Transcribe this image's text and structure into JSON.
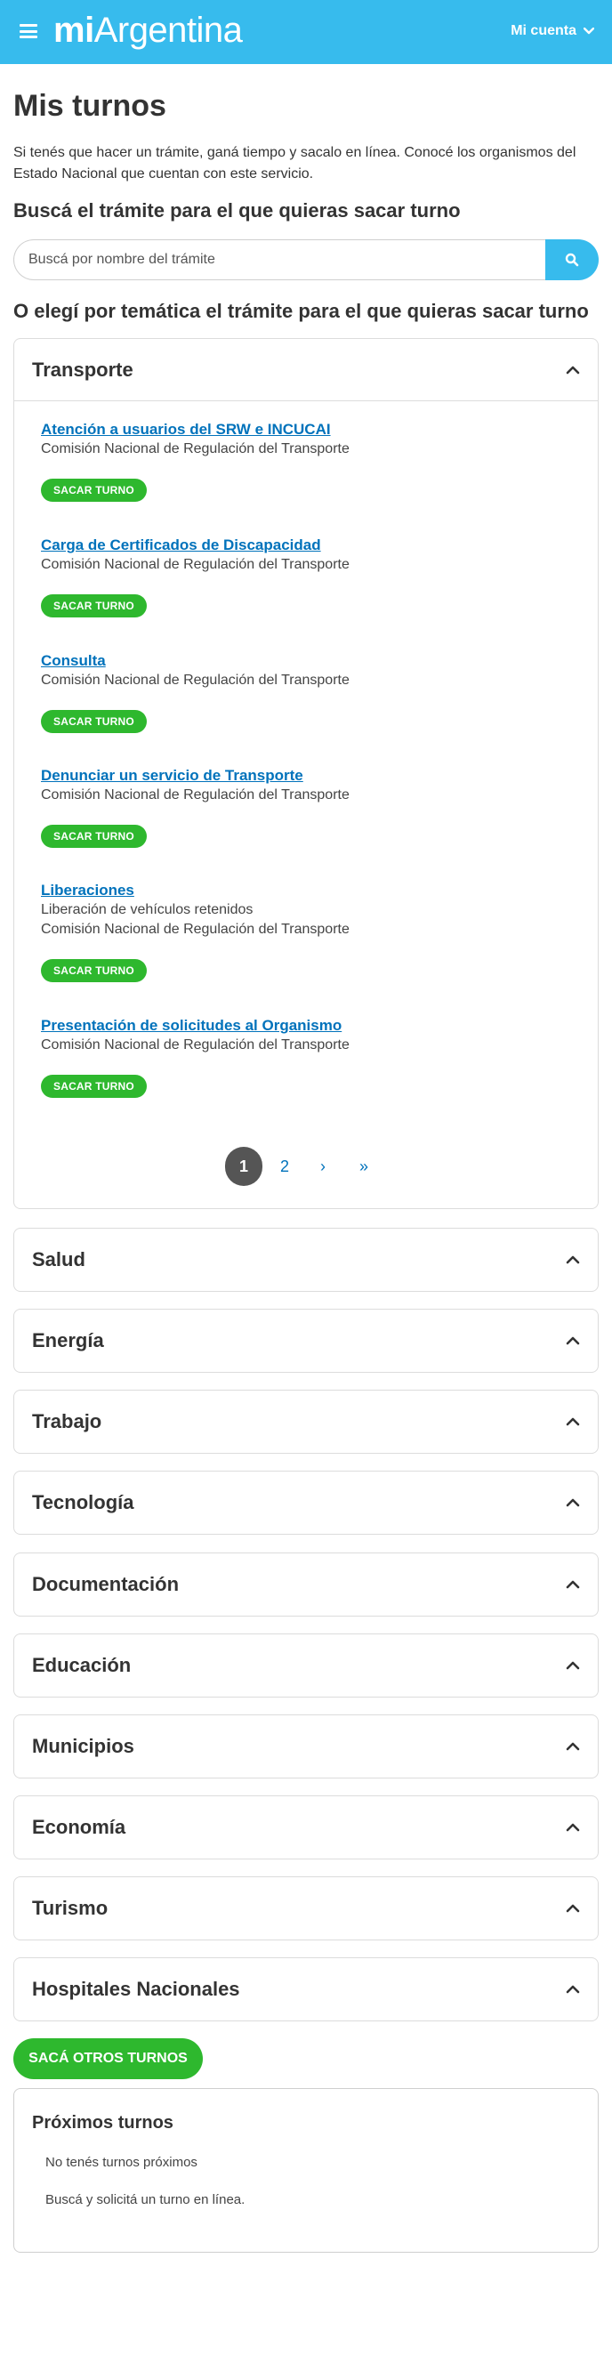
{
  "header": {
    "logo_bold": "mi",
    "logo_rest": "Argentina",
    "account_label": "Mi cuenta",
    "background_color": "#37bbed"
  },
  "page": {
    "title": "Mis turnos",
    "intro": "Si tenés que hacer un trámite, ganá tiempo y sacalo en línea. Conocé los organismos del Estado Nacional que cuentan con este servicio.",
    "search_heading": "Buscá el trámite para el que quieras sacar turno",
    "theme_heading": "O elegí por temática el trámite para el que quieras sacar turno"
  },
  "search": {
    "placeholder": "Buscá por nombre del trámite",
    "value": ""
  },
  "accordion": {
    "open_section": "Transporte",
    "tramites": [
      {
        "name": "Atención a usuarios del SRW e INCUCAI",
        "detail": "",
        "agency": "Comisión Nacional de Regulación del Transporte",
        "button": "SACAR TURNO"
      },
      {
        "name": "Carga de Certificados de Discapacidad",
        "detail": "",
        "agency": "Comisión Nacional de Regulación del Transporte",
        "button": "SACAR TURNO"
      },
      {
        "name": "Consulta",
        "detail": "",
        "agency": "Comisión Nacional de Regulación del Transporte",
        "button": "SACAR TURNO"
      },
      {
        "name": "Denunciar un servicio de Transporte",
        "detail": "",
        "agency": "Comisión Nacional de Regulación del Transporte",
        "button": "SACAR TURNO"
      },
      {
        "name": "Liberaciones",
        "detail": "Liberación de vehículos retenidos",
        "agency": "Comisión Nacional de Regulación del Transporte",
        "button": "SACAR TURNO"
      },
      {
        "name": "Presentación de solicitudes al Organismo",
        "detail": "",
        "agency": "Comisión Nacional de Regulación del Transporte",
        "button": "SACAR TURNO"
      }
    ],
    "pagination": {
      "current": "1",
      "next_page": "2",
      "next": "›",
      "last": "»"
    },
    "collapsed_sections": [
      "Salud",
      "Energía",
      "Trabajo",
      "Tecnología",
      "Documentación",
      "Educación",
      "Municipios",
      "Economía",
      "Turismo",
      "Hospitales Nacionales"
    ]
  },
  "cta": {
    "label": "SACÁ OTROS TURNOS"
  },
  "proximos": {
    "title": "Próximos turnos",
    "empty_message": "No tenés turnos próximos",
    "hint": "Buscá y solicitá un turno en línea."
  },
  "colors": {
    "accent_blue": "#37bbed",
    "link_blue": "#0072bb",
    "button_green": "#2eb82e",
    "pager_active": "#555555"
  },
  "icons": {
    "menu": "hamburger-menu-icon",
    "account_chevron": "chevron-down-icon",
    "search": "search-icon",
    "accordion_toggle": "chevron-up-icon"
  }
}
